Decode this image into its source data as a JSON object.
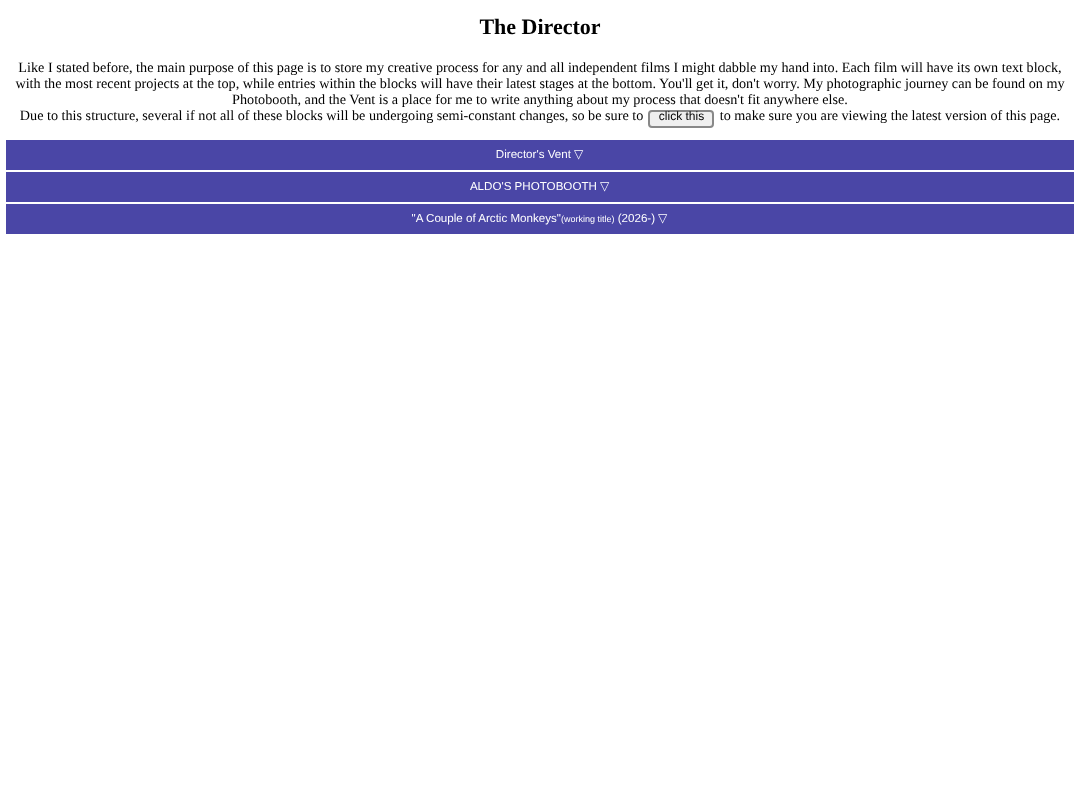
{
  "title": "The Director",
  "intro": "Like I stated before, the main purpose of this page is to store my creative process for any and all independent films I might dabble my hand into. Each film will have its own text block, with the most recent projects at the top, while entries within the blocks will have their latest stages at the bottom. You'll get it, don't worry. My photographic journey can be found on my Photobooth, and the Vent is a place for me to write anything about my process that doesn't fit anywhere else.",
  "notice": {
    "before": "Due to this structure, several if not all of these blocks will be undergoing semi-constant changes, so be sure to",
    "button": "click this",
    "after": "to make sure you are viewing the latest version of this page."
  },
  "blocks": [
    {
      "title": "Director's Vent",
      "toggle": "▽",
      "expanded": false
    },
    {
      "title": "ALDO'S PHOTOBOOTH",
      "toggle": "▽",
      "expanded": false
    },
    {
      "title": "\"A Couple of Arctic Monkeys\"",
      "note": "(working title)",
      "year": "(2026-)",
      "toggle": "▽",
      "expanded": false
    }
  ]
}
